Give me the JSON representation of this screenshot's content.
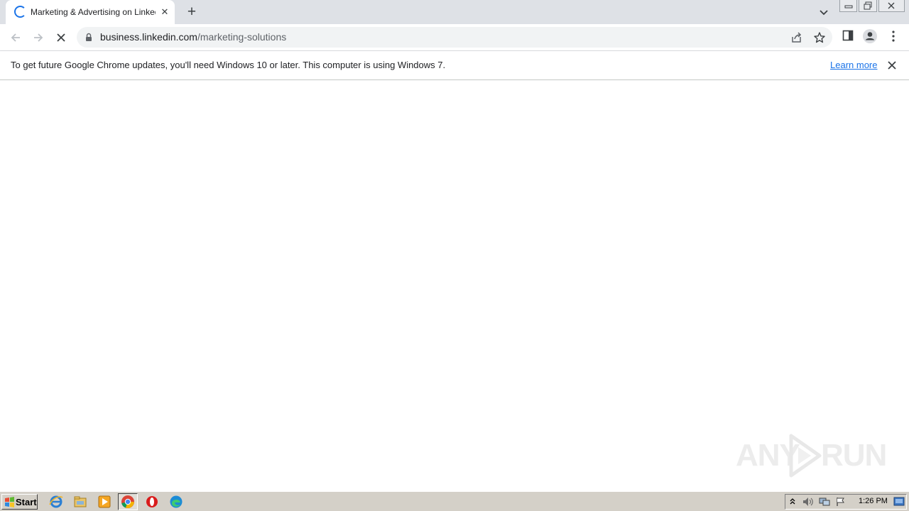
{
  "browser": {
    "tab": {
      "title": "Marketing & Advertising on LinkedIn",
      "loading": true,
      "close_icon": "close-icon"
    },
    "new_tab_label": "+",
    "url_host": "business.linkedin.com",
    "url_path": "/marketing-solutions",
    "infobar": {
      "message": "To get future Google Chrome updates, you'll need Windows 10 or later. This computer is using Windows 7.",
      "link_label": "Learn more"
    },
    "accent_color": "#1a73e8"
  },
  "watermark": {
    "left_text": "ANY",
    "right_text": "RUN"
  },
  "taskbar": {
    "start_label": "Start",
    "pinned": [
      "internet-explorer-icon",
      "file-explorer-icon",
      "media-player-icon",
      "chrome-icon",
      "opera-icon",
      "edge-icon"
    ],
    "clock": "1:26 PM"
  }
}
